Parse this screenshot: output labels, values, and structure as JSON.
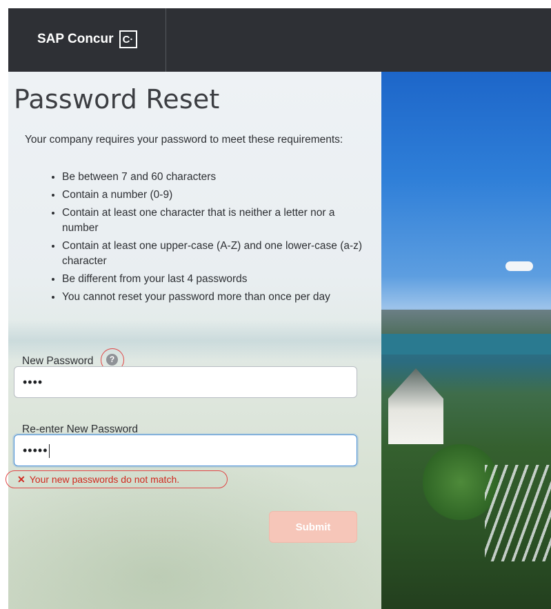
{
  "header": {
    "brand_text": "SAP Concur",
    "brand_mark": "C·"
  },
  "page": {
    "title": "Password Reset",
    "intro": "Your company requires your password to meet these requirements:",
    "requirements": [
      "Be between 7 and 60 characters",
      "Contain a number (0-9)",
      "Contain at least one character that is neither a letter nor a number",
      "Contain at least one upper-case (A-Z) and one lower-case (a-z) character",
      "Be different from your last 4 passwords",
      "You cannot reset your password more than once per day"
    ]
  },
  "form": {
    "new_password_label": "New Password",
    "new_password_value": "••••",
    "help_icon": "question-mark-icon",
    "reenter_label": "Re-enter New Password",
    "reenter_value": "•••••",
    "error_message": "Your new passwords do not match.",
    "error_icon": "x-icon",
    "submit_label": "Submit"
  },
  "colors": {
    "header_bg": "#2e3035",
    "error": "#d0281e",
    "submit_disabled": "#f6c6b9",
    "focus_border": "#4a8fd6"
  }
}
